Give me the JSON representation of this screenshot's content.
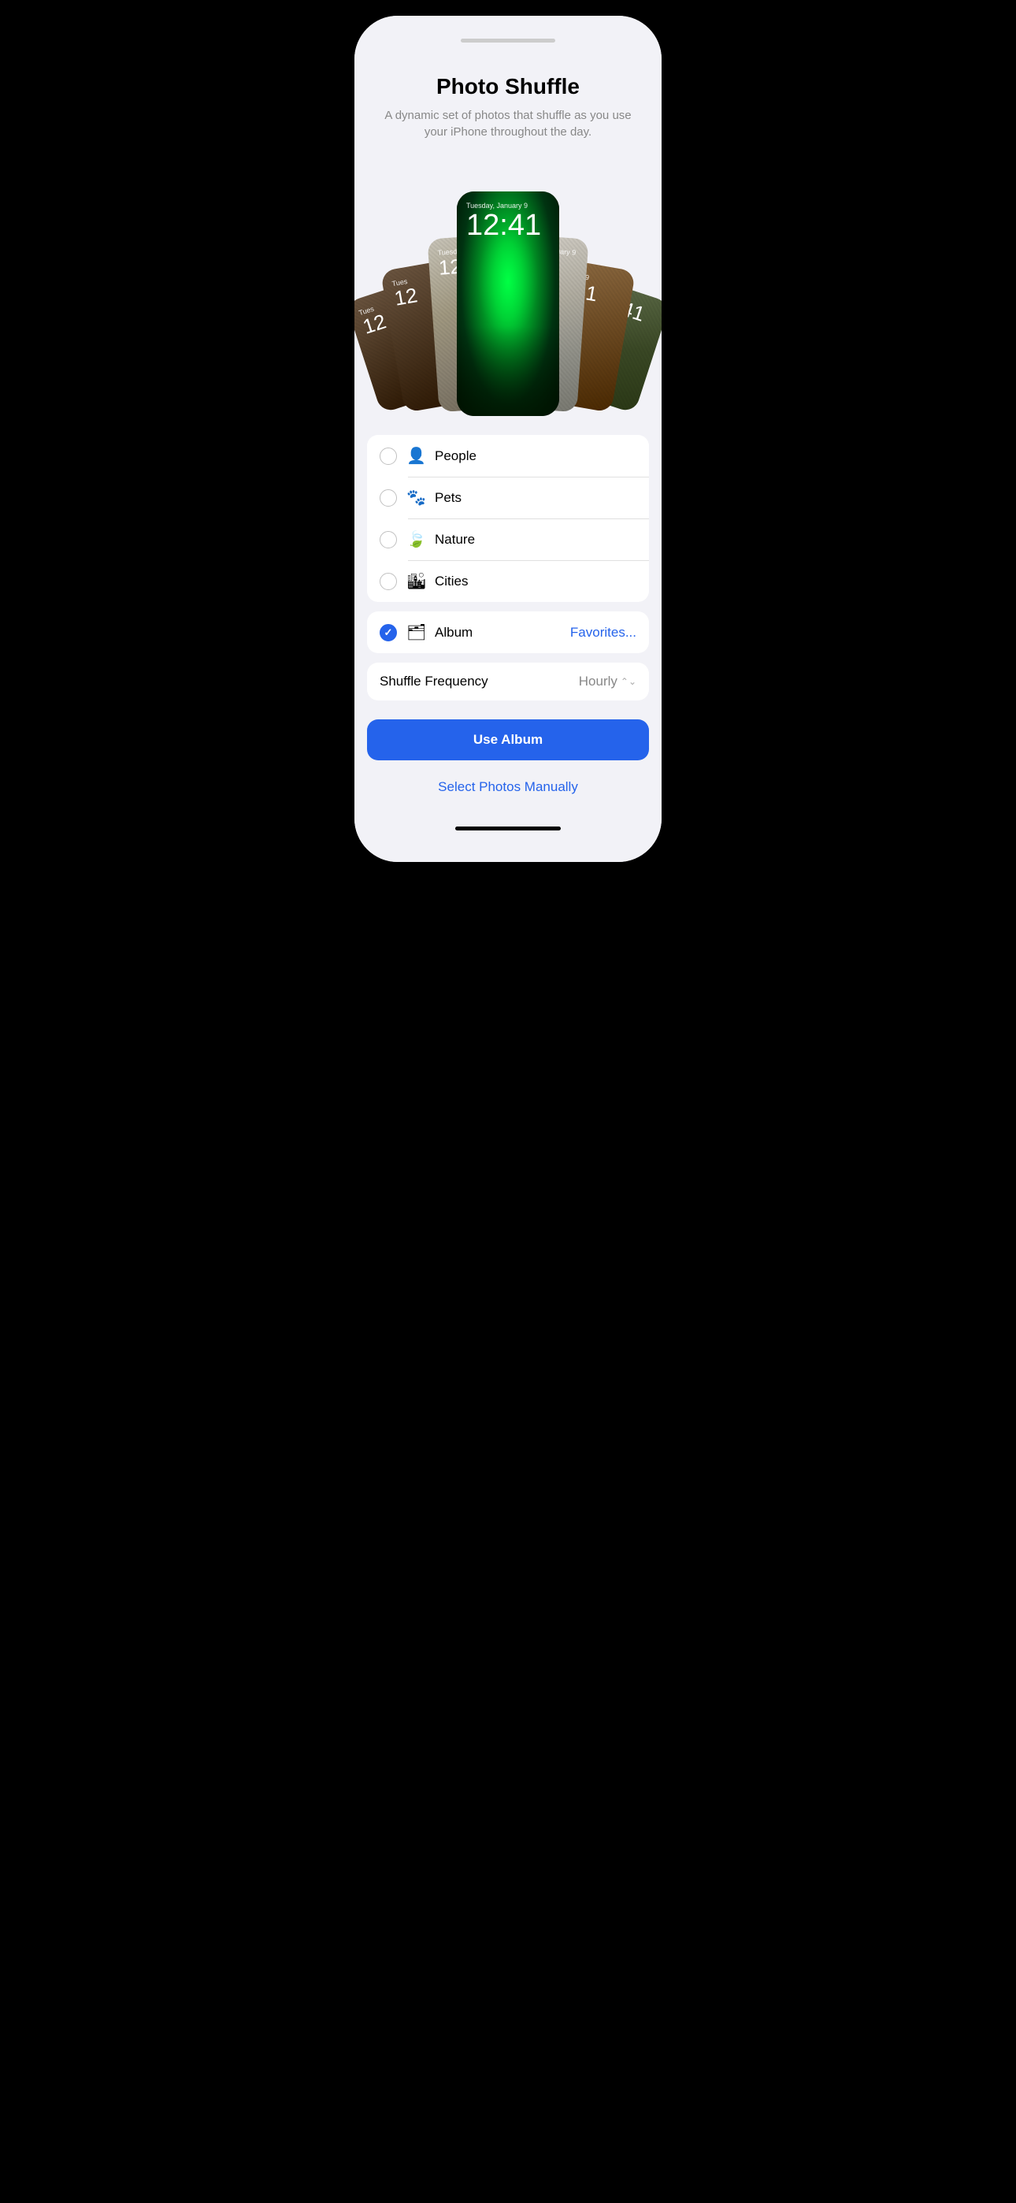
{
  "page": {
    "title": "Photo Shuffle",
    "subtitle": "A dynamic set of photos that shuffle as you use your iPhone throughout the day."
  },
  "carousel": {
    "time": "12:41",
    "date": "Tuesday, January 9"
  },
  "options": [
    {
      "id": "people",
      "label": "People",
      "icon": "person",
      "checked": false
    },
    {
      "id": "pets",
      "label": "Pets",
      "icon": "paw",
      "checked": false
    },
    {
      "id": "nature",
      "label": "Nature",
      "icon": "leaf",
      "checked": false
    },
    {
      "id": "cities",
      "label": "Cities",
      "icon": "building",
      "checked": false
    }
  ],
  "album": {
    "label": "Album",
    "link": "Favorites...",
    "checked": true,
    "icon": "album"
  },
  "shuffle": {
    "label": "Shuffle Frequency",
    "value": "Hourly"
  },
  "buttons": {
    "primary": "Use Album",
    "secondary": "Select Photos Manually"
  }
}
